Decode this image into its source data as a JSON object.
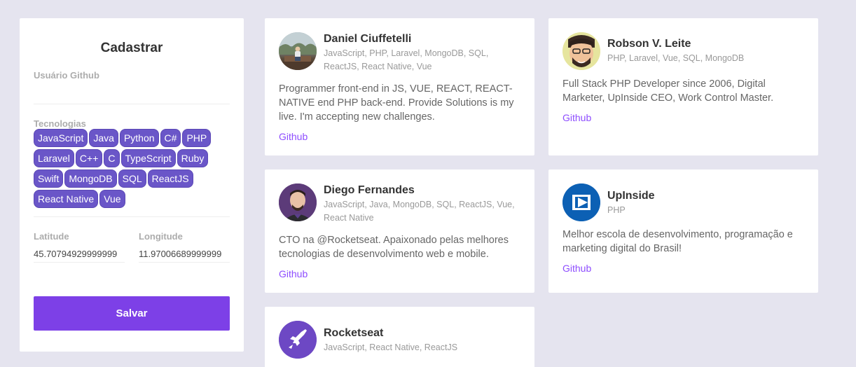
{
  "form": {
    "title": "Cadastrar",
    "github_label": "Usuário Github",
    "github_value": "",
    "techs_label": "Tecnologias",
    "techs": [
      "JavaScript",
      "Java",
      "Python",
      "C#",
      "PHP",
      "Laravel",
      "C++",
      "C",
      "TypeScript",
      "Ruby",
      "Swift",
      "MongoDB",
      "SQL",
      "ReactJS",
      "React Native",
      "Vue"
    ],
    "latitude_label": "Latitude",
    "latitude_value": "45.70794929999999",
    "longitude_label": "Longitude",
    "longitude_value": "11.97006689999999",
    "save_label": "Salvar"
  },
  "devs": [
    {
      "name": "Daniel Ciuffetelli",
      "techs": "JavaScript, PHP, Laravel, MongoDB, SQL, ReactJS, React Native, Vue",
      "bio": "Programmer front-end in JS, VUE, REACT, REACT-NATIVE end PHP back-end. Provide Solutions is my live. I'm accepting new challenges.",
      "link": "Github"
    },
    {
      "name": "Robson V. Leite",
      "techs": "PHP, Laravel, Vue, SQL, MongoDB",
      "bio": "Full Stack PHP Developer since 2006, Digital Marketer, UpInside CEO, Work Control Master.",
      "link": "Github"
    },
    {
      "name": "Diego Fernandes",
      "techs": "JavaScript, Java, MongoDB, SQL, ReactJS, Vue, React Native",
      "bio": "CTO na @Rocketseat. Apaixonado pelas melhores tecnologias de desenvolvimento web e mobile.",
      "link": "Github"
    },
    {
      "name": "UpInside",
      "techs": "PHP",
      "bio": "Melhor escola de desenvolvimento, programação e marketing digital do Brasil!",
      "link": "Github"
    },
    {
      "name": "Rocketseat",
      "techs": "JavaScript, React Native, ReactJS",
      "bio": "",
      "link": ""
    }
  ],
  "colors": {
    "background": "#e5e4ef",
    "accent": "#7d40e7",
    "chip": "#6a56c8",
    "link": "#8e4dff"
  }
}
